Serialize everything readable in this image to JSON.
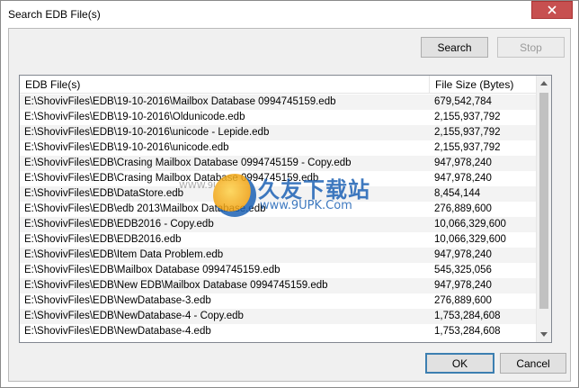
{
  "window": {
    "title": "Search EDB File(s)"
  },
  "toolbar": {
    "search_label": "Search",
    "stop_label": "Stop"
  },
  "table": {
    "columns": [
      "EDB File(s)",
      "File Size (Bytes)"
    ],
    "rows": [
      {
        "path": "E:\\ShovivFiles\\EDB\\19-10-2016\\Mailbox Database 0994745159.edb",
        "size": "679,542,784"
      },
      {
        "path": "E:\\ShovivFiles\\EDB\\19-10-2016\\Oldunicode.edb",
        "size": "2,155,937,792"
      },
      {
        "path": "E:\\ShovivFiles\\EDB\\19-10-2016\\unicode - Lepide.edb",
        "size": "2,155,937,792"
      },
      {
        "path": "E:\\ShovivFiles\\EDB\\19-10-2016\\unicode.edb",
        "size": "2,155,937,792"
      },
      {
        "path": "E:\\ShovivFiles\\EDB\\Crasing Mailbox Database 0994745159 - Copy.edb",
        "size": "947,978,240"
      },
      {
        "path": "E:\\ShovivFiles\\EDB\\Crasing Mailbox Database 0994745159.edb",
        "size": "947,978,240"
      },
      {
        "path": "E:\\ShovivFiles\\EDB\\DataStore.edb",
        "size": "8,454,144"
      },
      {
        "path": "E:\\ShovivFiles\\EDB\\edb 2013\\Mailbox Database.edb",
        "size": "276,889,600"
      },
      {
        "path": "E:\\ShovivFiles\\EDB\\EDB2016 - Copy.edb",
        "size": "10,066,329,600"
      },
      {
        "path": "E:\\ShovivFiles\\EDB\\EDB2016.edb",
        "size": "10,066,329,600"
      },
      {
        "path": "E:\\ShovivFiles\\EDB\\Item Data Problem.edb",
        "size": "947,978,240"
      },
      {
        "path": "E:\\ShovivFiles\\EDB\\Mailbox Database 0994745159.edb",
        "size": "545,325,056"
      },
      {
        "path": "E:\\ShovivFiles\\EDB\\New EDB\\Mailbox Database 0994745159.edb",
        "size": "947,978,240"
      },
      {
        "path": "E:\\ShovivFiles\\EDB\\NewDatabase-3.edb",
        "size": "276,889,600"
      },
      {
        "path": "E:\\ShovivFiles\\EDB\\NewDatabase-4 - Copy.edb",
        "size": "1,753,284,608"
      },
      {
        "path": "E:\\ShovivFiles\\EDB\\NewDatabase-4.edb",
        "size": "1,753,284,608"
      }
    ]
  },
  "footer": {
    "ok_label": "OK",
    "cancel_label": "Cancel"
  },
  "watermark": {
    "cn_text": "久友下载站",
    "url_text": "www.9UPK.Com",
    "small_text": "WWW.9UPK"
  },
  "colors": {
    "close_button": "#c75050",
    "default_button_border": "#3c7fb1",
    "watermark": "#1d62b5"
  },
  "icons": {
    "close": "close-icon",
    "scroll_up": "chevron-up-icon",
    "scroll_down": "chevron-down-icon"
  }
}
